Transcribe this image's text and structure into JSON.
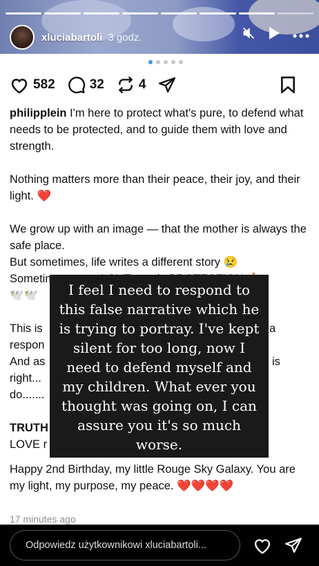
{
  "story": {
    "username": "xluciabartoli",
    "time": "3 godz.",
    "progress_segments": 8,
    "progress_done": 7
  },
  "post": {
    "carousel_dots": 5,
    "active_dot": 0,
    "likes": "582",
    "comments": "32",
    "reposts": "4",
    "caption_user": "philipplein",
    "caption_lines": [
      "I'm here to protect what's pure, to defend what needs to be protected, and to guide them with love and strength.",
      "Nothing matters more than their peace, their joy, and their light.",
      "We grow up with an image — that the mother is always the safe place.",
      "But sometimes, life writes a different story 😢",
      "Sometimes, even LOVE needs PROTECTION 🙏🏼",
      "🕊️🕊️",
      "This is",
      "a",
      "respon",
      "And as",
      "is",
      "right...",
      "do.......",
      "TRUTH",
      "LOVE r",
      "Happy 2nd Birthday, my little Rouge Sky Galaxy. You are my light, my purpose, my peace.",
      "17 minutes ago"
    ],
    "heart_emoji": "❤️"
  },
  "overlay": {
    "text": "I feel I need to respond to this false narrative which he is trying to portray. I've kept silent for too long, now I need to defend myself and my children. What ever you thought was going on, I can assure you it's so much worse."
  },
  "reply": {
    "placeholder": "Odpowiedz użytkownikowi xluciabartoli..."
  },
  "colors": {
    "accent_blue": "#3897f0",
    "heart_red": "#e0162b"
  }
}
